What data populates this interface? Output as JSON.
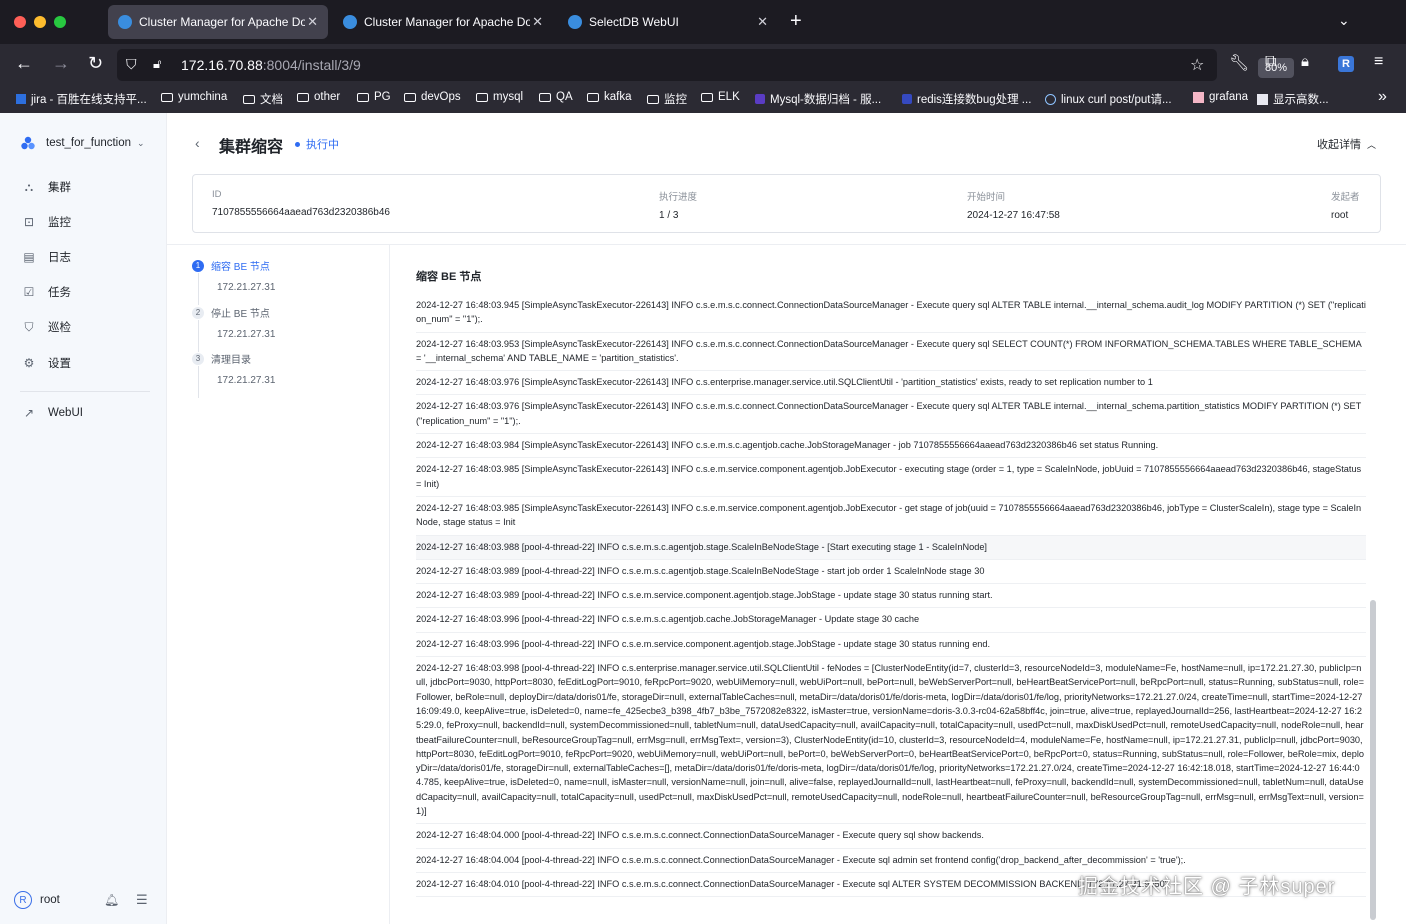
{
  "browser": {
    "tabs": [
      {
        "label": "Cluster Manager for Apache Doris",
        "active": true
      },
      {
        "label": "Cluster Manager for Apache Doris",
        "active": false
      },
      {
        "label": "SelectDB WebUI",
        "active": false
      }
    ],
    "url_host": "172.16.70.88",
    "url_rest": ":8004/install/3/9",
    "zoom": "80%",
    "ext_badge": "R",
    "bookmarks": [
      "jira - 百胜在线支持平...",
      "yumchina",
      "文档",
      "other",
      "PG",
      "devOps",
      "mysql",
      "QA",
      "kafka",
      "监控",
      "ELK",
      "Mysql-数据归档 - 服...",
      "redis连接数bug处理 ...",
      "linux curl post/put请...",
      "grafana",
      "显示高数..."
    ]
  },
  "sidebar": {
    "cluster_name": "test_for_function",
    "items": [
      {
        "label": "集群",
        "icon": "cluster-icon"
      },
      {
        "label": "监控",
        "icon": "monitor-icon"
      },
      {
        "label": "日志",
        "icon": "log-icon"
      },
      {
        "label": "任务",
        "icon": "task-icon"
      },
      {
        "label": "巡检",
        "icon": "inspect-icon"
      },
      {
        "label": "设置",
        "icon": "gear-icon"
      }
    ],
    "webui": "WebUI",
    "user": "root",
    "avatar_letter": "R"
  },
  "page": {
    "title": "集群缩容",
    "status": "执行中",
    "collapse_label": "收起详情",
    "fields": {
      "id_label": "ID",
      "id_value": "7107855556664aaead763d2320386b46",
      "progress_label": "执行进度",
      "progress_value": "1 / 3",
      "start_label": "开始时间",
      "start_value": "2024-12-27 16:47:58",
      "initiator_label": "发起者",
      "initiator_value": "root"
    }
  },
  "steps": [
    {
      "num": "1",
      "label": "缩容 BE 节点",
      "node": "172.21.27.31",
      "active": true
    },
    {
      "num": "2",
      "label": "停止 BE 节点",
      "node": "172.21.27.31",
      "active": false
    },
    {
      "num": "3",
      "label": "清理目录",
      "node": "172.21.27.31",
      "active": false
    }
  ],
  "log": {
    "title": "缩容 BE 节点",
    "lines": [
      "2024-12-27 16:48:03.945 [SimpleAsyncTaskExecutor-226143] INFO  c.s.e.m.s.c.connect.ConnectionDataSourceManager - Execute query sql ALTER TABLE internal.__internal_schema.audit_log MODIFY PARTITION (*) SET (\"replication_num\" = \"1\");.",
      "2024-12-27 16:48:03.953 [SimpleAsyncTaskExecutor-226143] INFO  c.s.e.m.s.c.connect.ConnectionDataSourceManager - Execute query sql SELECT COUNT(*) FROM INFORMATION_SCHEMA.TABLES WHERE TABLE_SCHEMA = '__internal_schema' AND TABLE_NAME = 'partition_statistics'.",
      "2024-12-27 16:48:03.976 [SimpleAsyncTaskExecutor-226143] INFO  c.s.enterprise.manager.service.util.SQLClientUtil - 'partition_statistics' exists, ready to set replication number to 1",
      "2024-12-27 16:48:03.976 [SimpleAsyncTaskExecutor-226143] INFO  c.s.e.m.s.c.connect.ConnectionDataSourceManager - Execute query sql ALTER TABLE internal.__internal_schema.partition_statistics MODIFY PARTITION (*) SET (\"replication_num\" = \"1\");.",
      "2024-12-27 16:48:03.984 [SimpleAsyncTaskExecutor-226143] INFO  c.s.e.m.s.c.agentjob.cache.JobStorageManager - job 7107855556664aaead763d2320386b46 set status Running.",
      "2024-12-27 16:48:03.985 [SimpleAsyncTaskExecutor-226143] INFO  c.s.e.m.service.component.agentjob.JobExecutor - executing stage (order = 1, type = ScaleInNode, jobUuid = 7107855556664aaead763d2320386b46, stageStatus = Init)",
      "2024-12-27 16:48:03.985 [SimpleAsyncTaskExecutor-226143] INFO  c.s.e.m.service.component.agentjob.JobExecutor - get stage of job(uuid = 7107855556664aaead763d2320386b46, jobType = ClusterScaleIn), stage type = ScaleInNode, stage status = Init",
      "2024-12-27 16:48:03.988 [pool-4-thread-22] INFO c.s.e.m.s.c.agentjob.stage.ScaleInBeNodeStage - [Start executing stage 1 - ScaleInNode]",
      "2024-12-27 16:48:03.989 [pool-4-thread-22] INFO  c.s.e.m.s.c.agentjob.stage.ScaleInBeNodeStage - start job order 1 ScaleInNode stage 30",
      "2024-12-27 16:48:03.989 [pool-4-thread-22] INFO  c.s.e.m.service.component.agentjob.stage.JobStage - update stage 30 status running start.",
      "2024-12-27 16:48:03.996 [pool-4-thread-22] INFO  c.s.e.m.s.c.agentjob.cache.JobStorageManager - Update stage 30 cache",
      "2024-12-27 16:48:03.996 [pool-4-thread-22] INFO  c.s.e.m.service.component.agentjob.stage.JobStage - update stage 30 status running end.",
      "2024-12-27 16:48:03.998 [pool-4-thread-22] INFO  c.s.enterprise.manager.service.util.SQLClientUtil - feNodes = [ClusterNodeEntity(id=7, clusterId=3, resourceNodeId=3, moduleName=Fe, hostName=null, ip=172.21.27.30, publicIp=null, jdbcPort=9030, httpPort=8030, feEditLogPort=9010, feRpcPort=9020, webUiMemory=null, webUiPort=null, bePort=null, beWebServerPort=null, beHeartBeatServicePort=null, beRpcPort=null, status=Running, subStatus=null, role=Follower, beRole=null, deployDir=/data/doris01/fe, storageDir=null, externalTableCaches=null, metaDir=/data/doris01/fe/doris-meta, logDir=/data/doris01/fe/log, priorityNetworks=172.21.27.0/24, createTime=null, startTime=2024-12-27 16:09:49.0, keepAlive=true, isDeleted=0, name=fe_425ecbe3_b398_4fb7_b3be_7572082e8322, isMaster=true, versionName=doris-3.0.3-rc04-62a58bff4c, join=true, alive=true, replayedJournalId=256, lastHeartbeat=2024-12-27 16:25:29.0, feProxy=null, backendId=null, systemDecommissioned=null, tabletNum=null, dataUsedCapacity=null, availCapacity=null, totalCapacity=null, usedPct=null, maxDiskUsedPct=null, remoteUsedCapacity=null, nodeRole=null, heartbeatFailureCounter=null, beResourceGroupTag=null, errMsg=null, errMsgText=, version=3), ClusterNodeEntity(id=10, clusterId=3, resourceNodeId=4, moduleName=Fe, hostName=null, ip=172.21.27.31, publicIp=null, jdbcPort=9030, httpPort=8030, feEditLogPort=9010, feRpcPort=9020, webUiMemory=null, webUiPort=null, bePort=0, beWebServerPort=0, beHeartBeatServicePort=0, beRpcPort=0, status=Running, subStatus=null, role=Follower, beRole=mix, deployDir=/data/doris01/fe, storageDir=null, externalTableCaches=[], metaDir=/data/doris01/fe/doris-meta, logDir=/data/doris01/fe/log, priorityNetworks=172.21.27.0/24, createTime=2024-12-27 16:42:18.018, startTime=2024-12-27 16:44:04.785, keepAlive=true, isDeleted=0, name=null, isMaster=null, versionName=null, join=null, alive=false, replayedJournalId=null, lastHeartbeat=null, feProxy=null, backendId=null, systemDecommissioned=null, tabletNum=null, dataUsedCapacity=null, availCapacity=null, totalCapacity=null, usedPct=null, maxDiskUsedPct=null, remoteUsedCapacity=null, nodeRole=null, heartbeatFailureCounter=null, beResourceGroupTag=null, errMsg=null, errMsgText=null, version=1)]",
      "2024-12-27 16:48:04.000 [pool-4-thread-22] INFO  c.s.e.m.s.c.connect.ConnectionDataSourceManager - Execute query sql show backends.",
      "2024-12-27 16:48:04.004 [pool-4-thread-22] INFO  c.s.e.m.s.c.connect.ConnectionDataSourceManager - Execute sql admin set frontend config('drop_backend_after_decommission' = 'true');.",
      "2024-12-27 16:48:04.010 [pool-4-thread-22] INFO  c.s.e.m.s.c.connect.ConnectionDataSourceManager - Execute sql ALTER SYSTEM DECOMMISSION BACKEND '172.21.27.31:9050'."
    ]
  },
  "watermark": "掘金技术社区 @ 子林super"
}
